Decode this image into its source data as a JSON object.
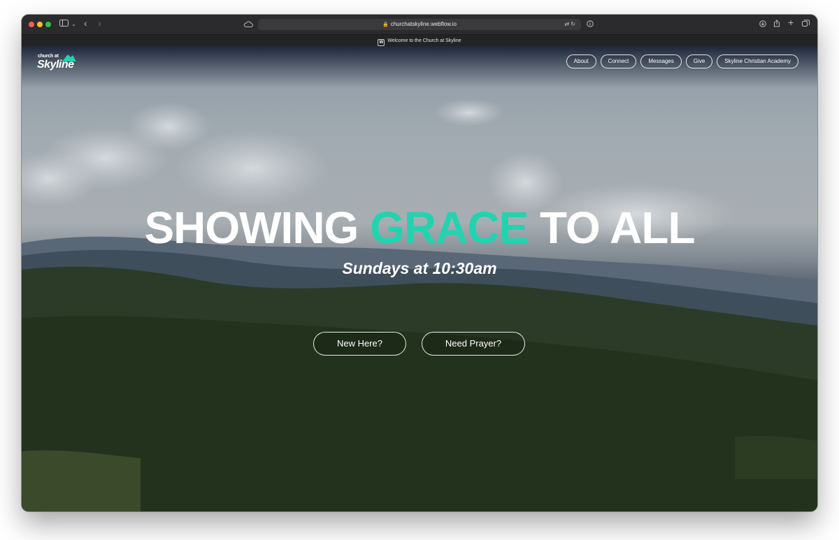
{
  "browser": {
    "url": "churchatskyline.webflow.io",
    "tab_title": "Welcome to the Church at Skyline",
    "favicon_letter": "W"
  },
  "site": {
    "logo": {
      "top": "church at",
      "main": "Skyline",
      "accent": "#22d3b0"
    },
    "nav": [
      {
        "label": "About"
      },
      {
        "label": "Connect"
      },
      {
        "label": "Messages"
      },
      {
        "label": "Give"
      },
      {
        "label": "Skyline Christian Academy"
      }
    ]
  },
  "hero": {
    "headline_before": "SHOWING ",
    "headline_accent": "GRACE",
    "headline_after": " TO ALL",
    "subtitle": "Sundays at 10:30am",
    "buttons": [
      {
        "label": "New Here?"
      },
      {
        "label": "Need Prayer?"
      }
    ]
  },
  "colors": {
    "accent": "#22d3b0",
    "text": "#ffffff"
  }
}
